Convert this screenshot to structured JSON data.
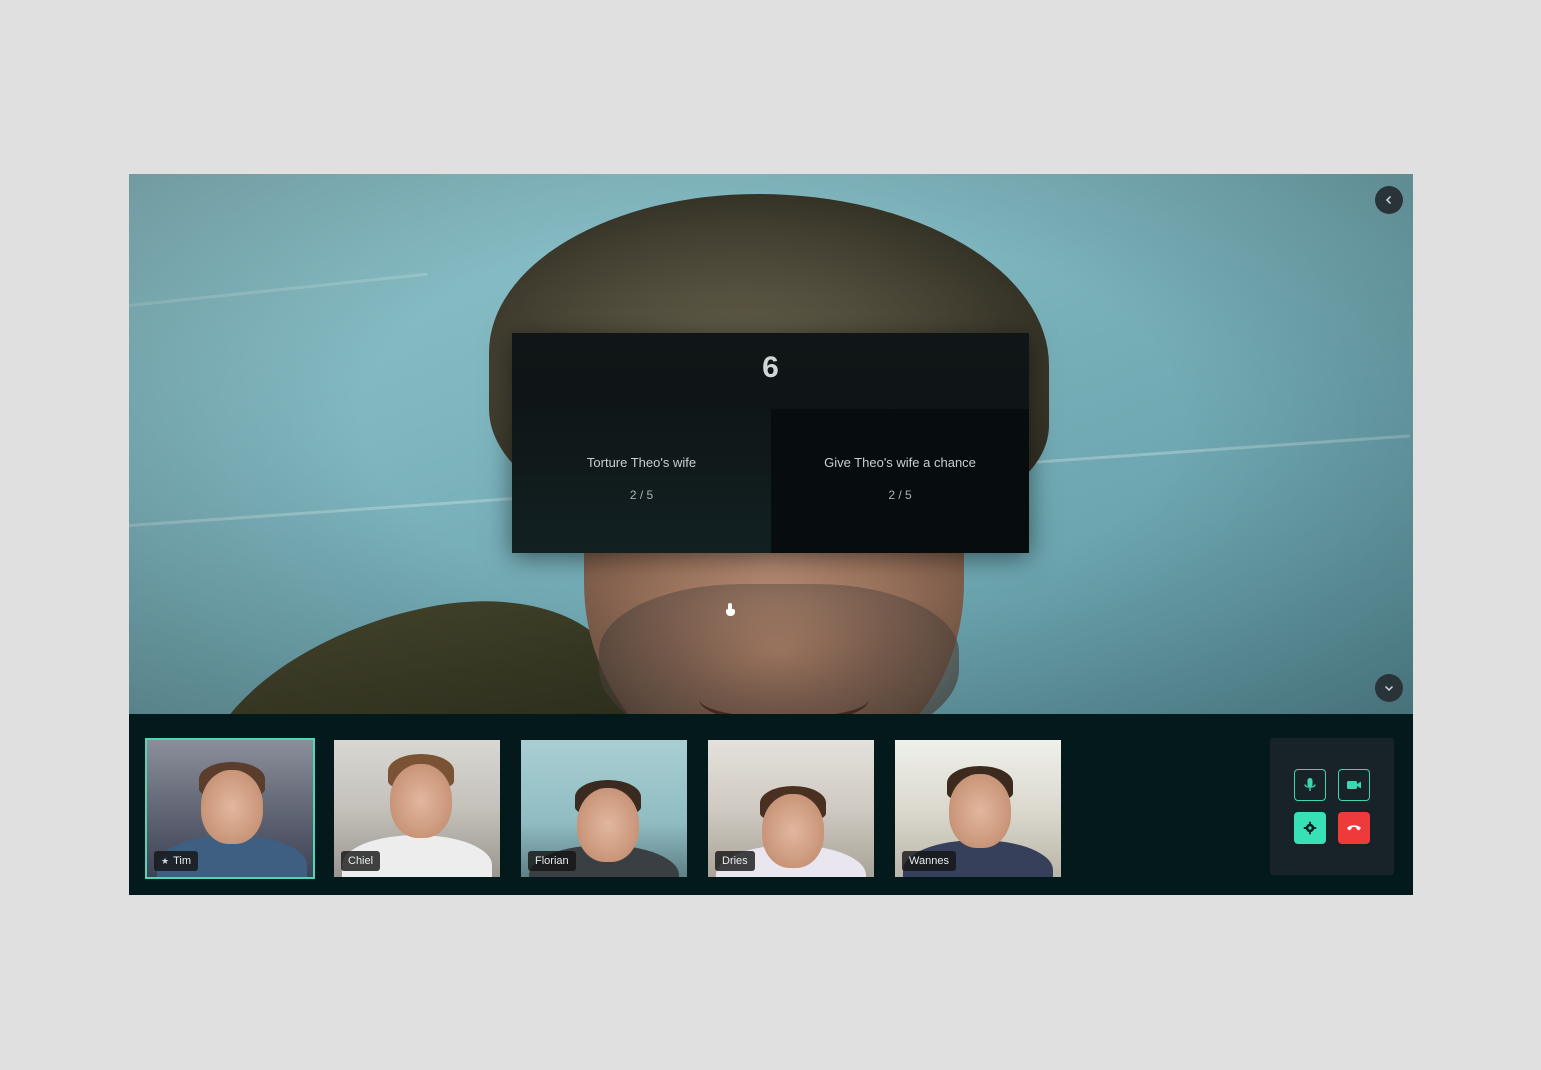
{
  "vote": {
    "timer": "6",
    "options": [
      {
        "label": "Torture Theo's wife",
        "score": "2 / 5"
      },
      {
        "label": "Give Theo's wife a chance",
        "score": "2 / 5"
      }
    ]
  },
  "stage_icons": {
    "top_right": "chevron-left-icon",
    "bottom_right": "chevron-down-icon"
  },
  "participants": [
    {
      "name": "Tim",
      "host": true,
      "active": true
    },
    {
      "name": "Chiel",
      "host": false,
      "active": false
    },
    {
      "name": "Florian",
      "host": false,
      "active": false
    },
    {
      "name": "Dries",
      "host": false,
      "active": false
    },
    {
      "name": "Wannes",
      "host": false,
      "active": false
    }
  ],
  "controls": [
    "microphone-icon",
    "camera-icon",
    "settings-icon",
    "hang-up-icon"
  ],
  "colors": {
    "accent": "#37e0b5",
    "danger": "#ee3a3a",
    "panel": "#03191c"
  }
}
